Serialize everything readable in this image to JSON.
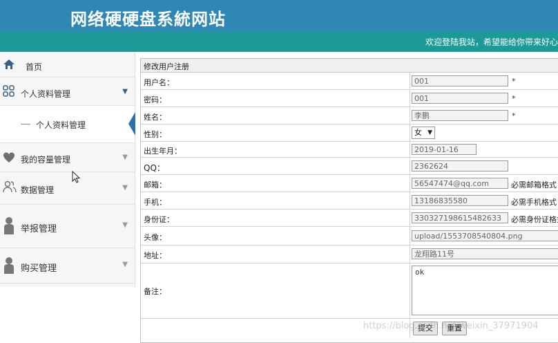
{
  "header": {
    "title": "网络硬硬盘系統网站",
    "welcome": "欢迎登陆我站，希望能给你带来好心"
  },
  "sidebar": {
    "items": [
      {
        "label": "首页",
        "icon": "home-icon"
      },
      {
        "label": "个人资料管理",
        "icon": "grid-icon",
        "sub": [
          "个人资料管理"
        ]
      },
      {
        "label": "我的容量管理",
        "icon": "heart-icon"
      },
      {
        "label": "数据管理",
        "icon": "users-icon"
      },
      {
        "label": "举报管理",
        "icon": "user-icon"
      },
      {
        "label": "购买管理",
        "icon": "user-icon"
      }
    ]
  },
  "form": {
    "title": "修改用户注册",
    "fields": {
      "username": {
        "label": "用户名：",
        "value": "001",
        "mark": "*"
      },
      "password": {
        "label": "密码：",
        "value": "001",
        "mark": "*"
      },
      "name": {
        "label": "姓名：",
        "value": "李鹏",
        "mark": "*"
      },
      "gender": {
        "label": "性别：",
        "value": "女"
      },
      "birth": {
        "label": "出生年月：",
        "value": "2019-01-16"
      },
      "qq": {
        "label": "QQ：",
        "value": "2362624"
      },
      "email": {
        "label": "邮箱：",
        "value": "56547474@qq.com",
        "hint": "必需邮箱格式"
      },
      "phone": {
        "label": "手机：",
        "value": "13186835580",
        "hint": "必需手机格式"
      },
      "idcard": {
        "label": "身份证：",
        "value": "330327198615482633",
        "hint": "必需身份证格式"
      },
      "avatar": {
        "label": "头像：",
        "value": "upload/1553708540804.png"
      },
      "address": {
        "label": "地址：",
        "value": "龙翔路11号"
      },
      "remark": {
        "label": "备注：",
        "value": "ok"
      }
    },
    "buttons": {
      "submit": "提交",
      "reset": "重置"
    }
  },
  "watermark": "https://blog.csdn.net/weixin_37971904"
}
